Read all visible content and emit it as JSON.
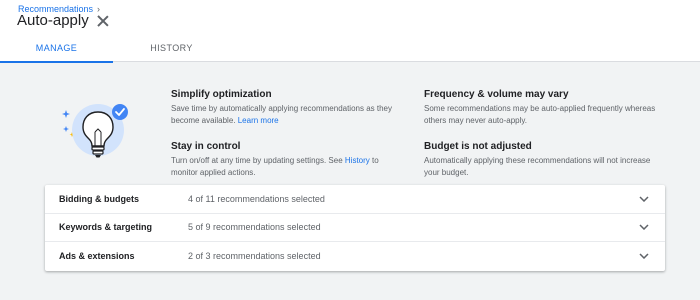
{
  "breadcrumb": {
    "label": "Recommendations"
  },
  "header": {
    "title": "Auto-apply"
  },
  "tabs": [
    {
      "label": "MANAGE",
      "active": true
    },
    {
      "label": "HISTORY",
      "active": false
    }
  ],
  "info": {
    "simplify": {
      "title": "Simplify optimization",
      "text": "Save time by automatically applying recommendations as they become available.",
      "link": "Learn more"
    },
    "control": {
      "title": "Stay in control",
      "text_before": "Turn on/off at any time by updating settings. See",
      "link": "History",
      "text_after": "to monitor applied actions."
    },
    "frequency": {
      "title": "Frequency & volume may vary",
      "text": "Some recommendations may be auto-applied frequently whereas others may never auto-apply."
    },
    "budget": {
      "title": "Budget is not adjusted",
      "text": "Automatically applying these recommendations will not increase your budget."
    }
  },
  "categories": [
    {
      "name": "Bidding & budgets",
      "summary": "4 of 11 recommendations selected"
    },
    {
      "name": "Keywords & targeting",
      "summary": "5 of 9 recommendations selected"
    },
    {
      "name": "Ads & extensions",
      "summary": "2 of 3 recommendations selected"
    }
  ],
  "colors": {
    "accent": "#1a73e8",
    "background": "#f1f3f4",
    "sparkle_blue": "#4285f4",
    "sparkle_yellow": "#fbbc04"
  },
  "icons": {
    "illustration": "lightbulb-check-icon",
    "close": "close-icon",
    "breadcrumb_separator": "chevron-right-icon",
    "expand": "chevron-down-icon"
  }
}
